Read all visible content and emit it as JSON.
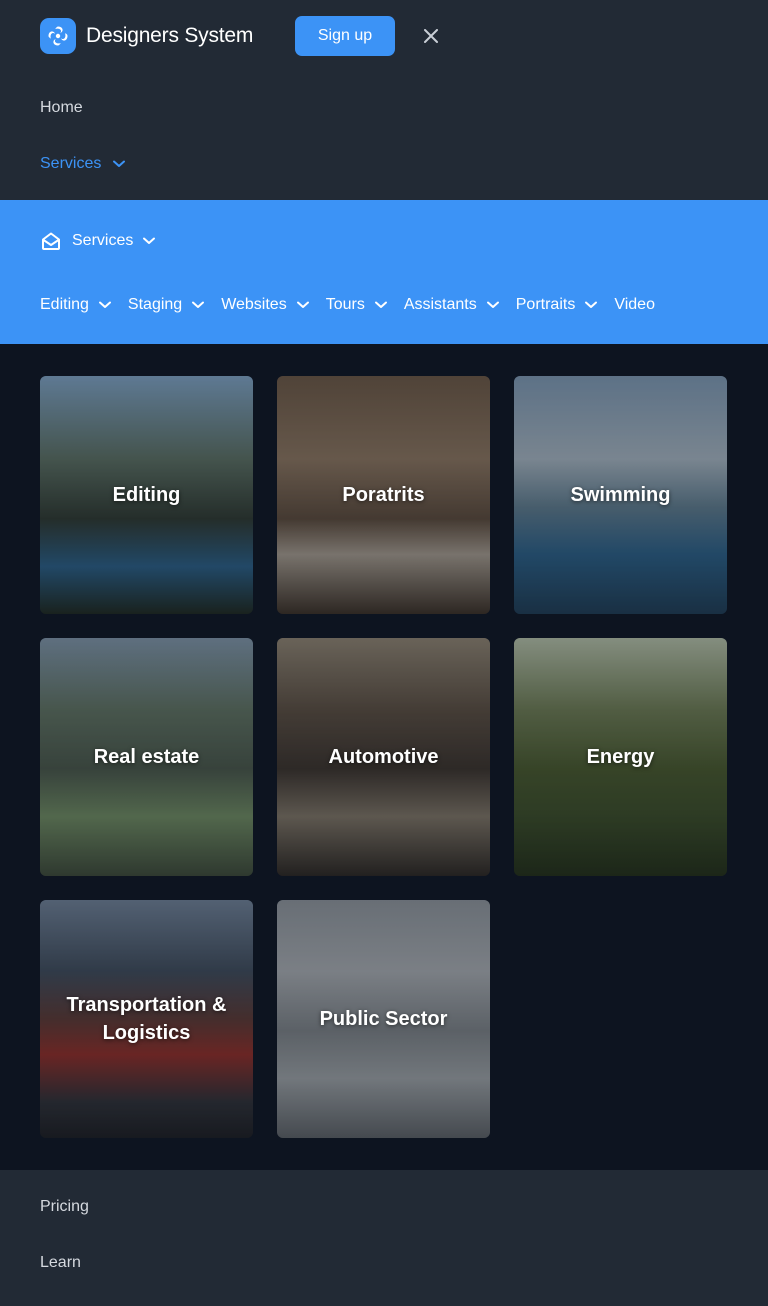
{
  "header": {
    "brand_name": "Designers System",
    "logo_icon": "swirl-logo-icon",
    "signup_label": "Sign up",
    "close_icon": "close-icon"
  },
  "nav": {
    "home": "Home",
    "services": "Services",
    "pricing": "Pricing",
    "learn": "Learn"
  },
  "submenu": {
    "title": "Services",
    "tabs": [
      {
        "label": "Editing",
        "has_dropdown": true
      },
      {
        "label": "Staging",
        "has_dropdown": true
      },
      {
        "label": "Websites",
        "has_dropdown": true
      },
      {
        "label": "Tours",
        "has_dropdown": true
      },
      {
        "label": "Assistants",
        "has_dropdown": true
      },
      {
        "label": "Portraits",
        "has_dropdown": true
      },
      {
        "label": "Video",
        "has_dropdown": false
      }
    ]
  },
  "cards": [
    {
      "label": "Editing"
    },
    {
      "label": "Poratrits"
    },
    {
      "label": "Swimming"
    },
    {
      "label": "Real estate"
    },
    {
      "label": "Automotive"
    },
    {
      "label": "Energy"
    },
    {
      "label": "Transportation & Logistics"
    },
    {
      "label": "Public Sector"
    }
  ],
  "colors": {
    "accent": "#3c93f6",
    "header_bg": "#222a35",
    "page_bg": "#0d1420"
  }
}
